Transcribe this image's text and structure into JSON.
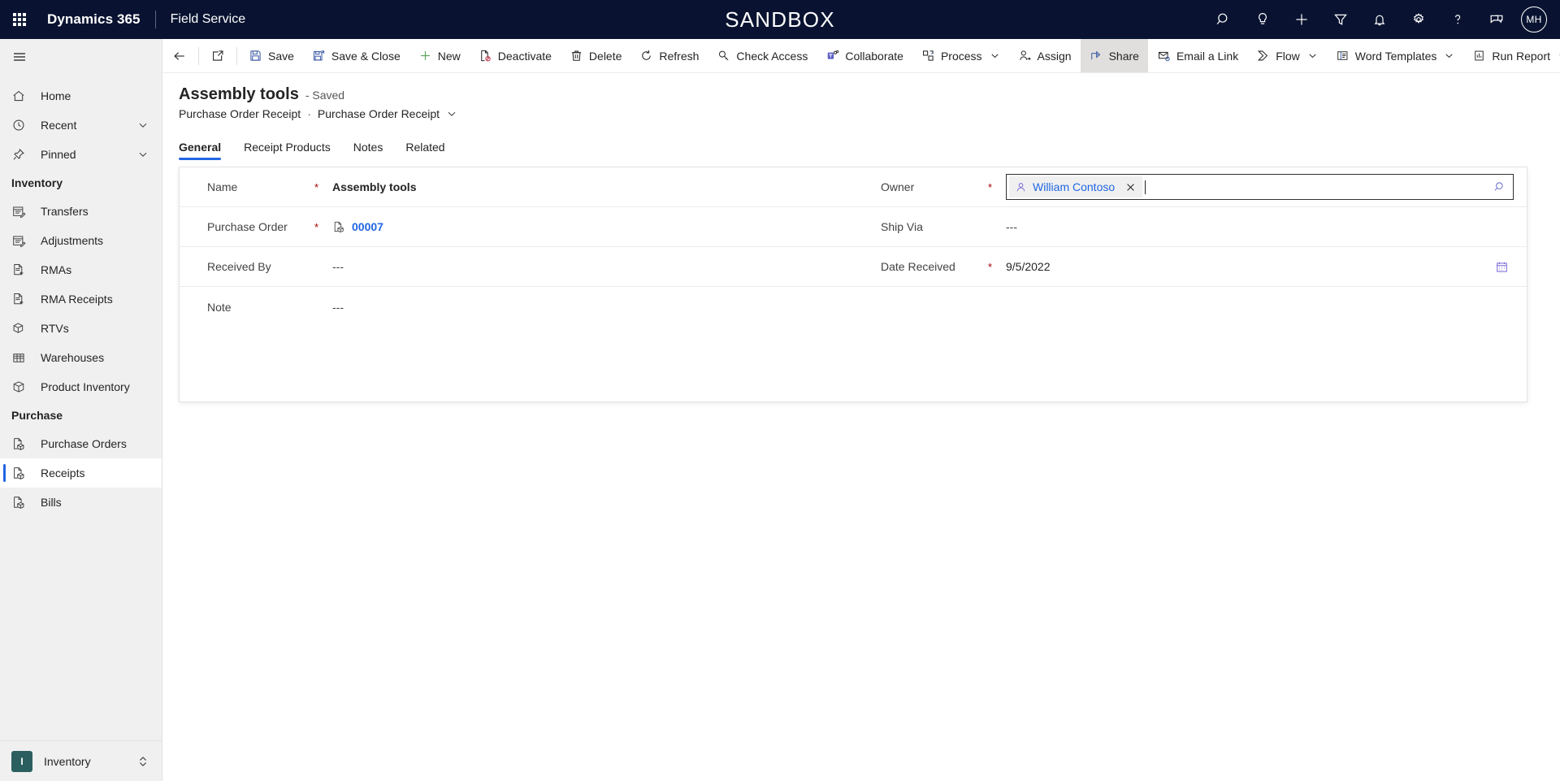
{
  "topnav": {
    "waffle_icon": "app-launcher-icon",
    "brand": "Dynamics 365",
    "app_name": "Field Service",
    "banner": "SANDBOX",
    "icons": [
      {
        "name": "search-icon",
        "label": "Search"
      },
      {
        "name": "lightbulb-icon",
        "label": "Insights"
      },
      {
        "name": "plus-icon",
        "label": "Quick create"
      },
      {
        "name": "filter-icon",
        "label": "Filter"
      },
      {
        "name": "bell-icon",
        "label": "Notifications"
      },
      {
        "name": "gear-icon",
        "label": "Settings"
      },
      {
        "name": "help-icon",
        "label": "Help"
      },
      {
        "name": "feedback-icon",
        "label": "Feedback"
      }
    ],
    "avatar_initials": "MH"
  },
  "sidebar": {
    "hamburger_icon": "hamburger-icon",
    "items": [
      {
        "label": "Home",
        "icon": "home-icon",
        "chevron": false,
        "selected": false
      },
      {
        "label": "Recent",
        "icon": "clock-icon",
        "chevron": true,
        "selected": false
      },
      {
        "label": "Pinned",
        "icon": "pin-icon",
        "chevron": true,
        "selected": false
      }
    ],
    "groups": [
      {
        "title": "Inventory",
        "items": [
          {
            "label": "Transfers",
            "icon": "calendar-edit-icon",
            "selected": false
          },
          {
            "label": "Adjustments",
            "icon": "calendar-edit-icon",
            "selected": false
          },
          {
            "label": "RMAs",
            "icon": "document-return-icon",
            "selected": false
          },
          {
            "label": "RMA Receipts",
            "icon": "document-return-icon",
            "selected": false
          },
          {
            "label": "RTVs",
            "icon": "box-return-icon",
            "selected": false
          },
          {
            "label": "Warehouses",
            "icon": "building-icon",
            "selected": false
          },
          {
            "label": "Product Inventory",
            "icon": "box-icon",
            "selected": false
          }
        ]
      },
      {
        "title": "Purchase",
        "items": [
          {
            "label": "Purchase Orders",
            "icon": "document-box-icon",
            "selected": false
          },
          {
            "label": "Receipts",
            "icon": "document-box-icon",
            "selected": true
          },
          {
            "label": "Bills",
            "icon": "document-box-icon",
            "selected": false
          }
        ]
      }
    ],
    "area_switcher": {
      "badge": "I",
      "label": "Inventory",
      "chevron_icon": "chevron-updown-icon"
    }
  },
  "commandbar": {
    "back_icon": "back-arrow-icon",
    "popout_icon": "open-in-new-window-icon",
    "buttons": [
      {
        "label": "Save",
        "icon": "save-icon",
        "chevron": false,
        "active": false
      },
      {
        "label": "Save & Close",
        "icon": "save-close-icon",
        "chevron": false,
        "active": false
      },
      {
        "label": "New",
        "icon": "plus-icon",
        "chevron": false,
        "active": false
      },
      {
        "label": "Deactivate",
        "icon": "deactivate-icon",
        "chevron": false,
        "active": false
      },
      {
        "label": "Delete",
        "icon": "trash-icon",
        "chevron": false,
        "active": false
      },
      {
        "label": "Refresh",
        "icon": "refresh-icon",
        "chevron": false,
        "active": false
      },
      {
        "label": "Check Access",
        "icon": "key-icon",
        "chevron": false,
        "active": false
      },
      {
        "label": "Collaborate",
        "icon": "teams-icon",
        "chevron": false,
        "active": false
      },
      {
        "label": "Process",
        "icon": "process-icon",
        "chevron": true,
        "active": false
      },
      {
        "label": "Assign",
        "icon": "assign-user-icon",
        "chevron": false,
        "active": false
      },
      {
        "label": "Share",
        "icon": "share-icon",
        "chevron": false,
        "active": true
      },
      {
        "label": "Email a Link",
        "icon": "email-link-icon",
        "chevron": false,
        "active": false
      },
      {
        "label": "Flow",
        "icon": "flow-icon",
        "chevron": true,
        "active": false
      },
      {
        "label": "Word Templates",
        "icon": "word-template-icon",
        "chevron": true,
        "active": false
      },
      {
        "label": "Run Report",
        "icon": "report-icon",
        "chevron": true,
        "active": false
      }
    ]
  },
  "form": {
    "title": "Assembly tools",
    "save_state": "- Saved",
    "breadcrumb": {
      "parent": "Purchase Order Receipt",
      "separator": "·",
      "current": "Purchase Order Receipt",
      "chevron_icon": "chevron-down-icon"
    },
    "tabs": [
      {
        "label": "General",
        "selected": true
      },
      {
        "label": "Receipt Products",
        "selected": false
      },
      {
        "label": "Notes",
        "selected": false
      },
      {
        "label": "Related",
        "selected": false
      }
    ],
    "left_fields": [
      {
        "label": "Name",
        "required": true,
        "value": "Assembly tools",
        "style": "bold",
        "icon": null
      },
      {
        "label": "Purchase Order",
        "required": true,
        "value": "00007",
        "style": "link",
        "icon": "document-box-icon"
      },
      {
        "label": "Received By",
        "required": false,
        "value": "---",
        "style": "empty",
        "icon": null
      },
      {
        "label": "Note",
        "required": false,
        "value": "---",
        "style": "empty",
        "icon": null
      }
    ],
    "owner_field": {
      "label": "Owner",
      "required": true,
      "chip_icon": "person-icon",
      "chip_text": "William Contoso",
      "remove_icon": "close-icon",
      "search_icon": "search-icon"
    },
    "ship_via": {
      "label": "Ship Via",
      "required": false,
      "value": "---"
    },
    "date_received": {
      "label": "Date Received",
      "required": true,
      "value": "9/5/2022",
      "calendar_icon": "calendar-icon"
    },
    "required_marker": "*"
  },
  "colors": {
    "nav_bg": "#091331",
    "accent": "#2266e3",
    "required": "#a80000",
    "sidebar_bg": "#f0f0f0",
    "area_badge": "#2b5f5f"
  }
}
